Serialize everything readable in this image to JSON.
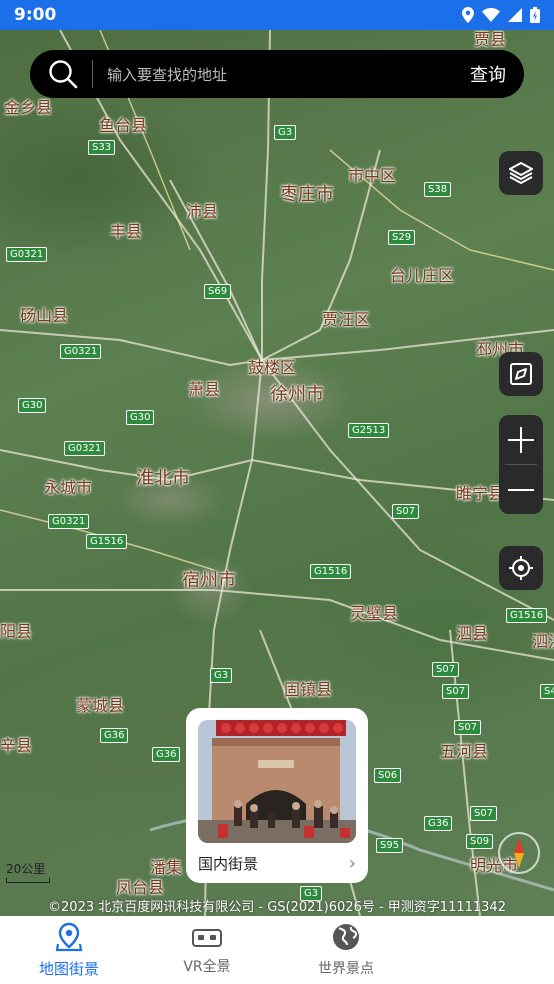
{
  "status_bar": {
    "time": "9:00"
  },
  "search": {
    "placeholder": "输入要查找的地址",
    "button_label": "查询"
  },
  "map": {
    "places": [
      {
        "name": "贾县",
        "id": "jia"
      },
      {
        "name": "金乡县",
        "id": "jinxiang"
      },
      {
        "name": "鱼台县",
        "id": "yutai"
      },
      {
        "name": "市中区",
        "id": "shizhong"
      },
      {
        "name": "枣庄市",
        "id": "zaozhuang"
      },
      {
        "name": "沛县",
        "id": "peixian"
      },
      {
        "name": "丰县",
        "id": "fengxian"
      },
      {
        "name": "台儿庄区",
        "id": "taierzhuang"
      },
      {
        "name": "砀山县",
        "id": "dangshan"
      },
      {
        "name": "贾汪区",
        "id": "jiawang"
      },
      {
        "name": "邳州市",
        "id": "pizhou"
      },
      {
        "name": "鼓楼区",
        "id": "gulou"
      },
      {
        "name": "萧县",
        "id": "xiaoxian"
      },
      {
        "name": "徐州市",
        "id": "xuzhou"
      },
      {
        "name": "淮北市",
        "id": "huaibei"
      },
      {
        "name": "永城市",
        "id": "yongcheng"
      },
      {
        "name": "睢宁县",
        "id": "suining"
      },
      {
        "name": "宿州市",
        "id": "suzhou"
      },
      {
        "name": "灵璧县",
        "id": "lingbi"
      },
      {
        "name": "泗县",
        "id": "sixian"
      },
      {
        "name": "泗洪",
        "id": "sihong"
      },
      {
        "name": "阳县",
        "id": "yang"
      },
      {
        "name": "蒙城县",
        "id": "mengcheng"
      },
      {
        "name": "固镇县",
        "id": "guzhen"
      },
      {
        "name": "辛县",
        "id": "xin"
      },
      {
        "name": "五河县",
        "id": "wuhe"
      },
      {
        "name": "凤台县",
        "id": "fengtai"
      },
      {
        "name": "潘集",
        "id": "panji"
      },
      {
        "name": "明光市",
        "id": "mingguang"
      }
    ],
    "road_shields": [
      "S33",
      "G3",
      "S38",
      "G0321",
      "S29",
      "S69",
      "G0321",
      "G30",
      "G30",
      "G0321",
      "G2513",
      "G0321",
      "G1516",
      "S07",
      "G1516",
      "G1516",
      "G3",
      "S07",
      "S07",
      "S07",
      "G36",
      "G36",
      "S06",
      "G36",
      "S95",
      "S09",
      "S07",
      "S4",
      "G3"
    ],
    "scale_label": "20公里"
  },
  "card": {
    "title": "国内街景"
  },
  "copyright": "©2023 北京百度网讯科技有限公司 - GS(2021)6026号 - 甲测资字11111342",
  "tabs": [
    {
      "label": "地图街景",
      "icon": "map-pin-icon",
      "active": true
    },
    {
      "label": "VR全景",
      "icon": "vr-glasses-icon",
      "active": false
    },
    {
      "label": "世界景点",
      "icon": "globe-icon",
      "active": false
    }
  ],
  "colors": {
    "accent": "#1b6fe8",
    "place_text": "#7a3a1a",
    "shield": "#2e8b3e"
  }
}
